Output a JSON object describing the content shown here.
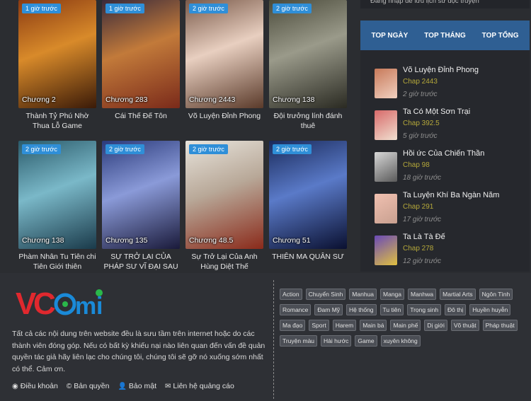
{
  "sidebar_top_text": "Đăng nhập để lưu lịch sử đọc truyện",
  "manga_grid": [
    {
      "badge": "1 giờ trước",
      "chapter": "Chương 2",
      "title": "Thành Tỷ Phú Nhờ Thua Lỗ Game",
      "colors": [
        "#8a3a12",
        "#d88a2a",
        "#3a1a08"
      ]
    },
    {
      "badge": "1 giờ trước",
      "chapter": "Chương 283",
      "title": "Cái Thế Đế Tôn",
      "colors": [
        "#3a2a3a",
        "#c27a3a",
        "#7a2a1a"
      ]
    },
    {
      "badge": "2 giờ trước",
      "chapter": "Chương 2443",
      "title": "Võ Luyện Đỉnh Phong",
      "colors": [
        "#7a5a4a",
        "#e8cfc0",
        "#5a3a2a"
      ]
    },
    {
      "badge": "2 giờ trước",
      "chapter": "Chương 138",
      "title": "Đội trưởng lính đánh thuê",
      "colors": [
        "#4a4a3a",
        "#9a9a8a",
        "#2a2a22"
      ]
    },
    {
      "badge": "2 giờ trước",
      "chapter": "Chương 138",
      "title": "Phàm Nhân Tu Tiên chi Tiên Giới thiên",
      "colors": [
        "#2a5a6a",
        "#7ab8c8",
        "#1a3a4a"
      ]
    },
    {
      "badge": "2 giờ trước",
      "chapter": "Chương 135",
      "title": "SỰ TRỞ LẠI CỦA PHÁP SƯ VĨ ĐẠI SAU",
      "colors": [
        "#2a3a7a",
        "#8a9ad8",
        "#1a1a3a"
      ]
    },
    {
      "badge": "2 giờ trước",
      "chapter": "Chương 48.5",
      "title": "Sự Trở Lại Của Anh Hùng Diệt Thế",
      "colors": [
        "#e8e4dc",
        "#b8a898",
        "#8a2a1a"
      ]
    },
    {
      "badge": "2 giờ trước",
      "chapter": "Chương 51",
      "title": "THIÊN MA QUÂN SƯ",
      "colors": [
        "#1a2a5a",
        "#5a7ac8",
        "#0a1030"
      ]
    }
  ],
  "sidebar": {
    "tabs": [
      "TOP NGÀY",
      "TOP THÁNG",
      "TOP TỔNG"
    ],
    "ranks": [
      {
        "title": "Võ Luyện Đỉnh Phong",
        "chapter": "Chap 2443",
        "time": "2 giờ trước",
        "colors": [
          "#c87a5a",
          "#f0d0c0"
        ]
      },
      {
        "title": "Ta Có Một Sơn Trại",
        "chapter": "Chap 392.5",
        "time": "5 giờ trước",
        "colors": [
          "#d86a6a",
          "#f0e0d0"
        ]
      },
      {
        "title": "Hồi ức Của Chiến Thần",
        "chapter": "Chap 98",
        "time": "18 giờ trước",
        "colors": [
          "#d8d8d8",
          "#5a5a5a"
        ]
      },
      {
        "title": "Ta Luyện Khí Ba Ngàn Năm",
        "chapter": "Chap 291",
        "time": "17 giờ trước",
        "colors": [
          "#f0c0b0",
          "#c8a090"
        ]
      },
      {
        "title": "Ta Là Tà Đế",
        "chapter": "Chap 278",
        "time": "12 giờ trước",
        "colors": [
          "#6a4ab8",
          "#e0c040"
        ]
      }
    ]
  },
  "footer": {
    "logo": {
      "v": "V",
      "c": "C",
      "o": "o",
      "m": "m",
      "i": "i",
      "colors": {
        "red": "#e0282e",
        "blue": "#1a8ad8",
        "green": "#2ab84a"
      }
    },
    "about": "Tất cả các nội dung trên website đều là sưu tầm trên internet hoặc do các thành viên đóng góp. Nếu có bất kỳ khiếu nại nào liên quan đến vấn đề quản quyền tác giả hãy liên lạc cho chúng tôi, chúng tôi sẽ gỡ nó xuống sớm nhất có thể. Cảm ơn.",
    "links": [
      {
        "icon": "circle-info-icon",
        "glyph": "◉",
        "label": "Điều khoản"
      },
      {
        "icon": "copyright-icon",
        "glyph": "©",
        "label": "Bản quyền"
      },
      {
        "icon": "user-shield-icon",
        "glyph": "👤",
        "label": "Bảo mật"
      },
      {
        "icon": "envelope-icon",
        "glyph": "✉",
        "label": "Liên hệ quảng cáo"
      }
    ],
    "tags": [
      "Action",
      "Chuyển Sinh",
      "Manhua",
      "Manga",
      "Manhwa",
      "Martial Arts",
      "Ngôn Tình",
      "Romance",
      "Đam Mỹ",
      "Hệ thống",
      "Tu tiên",
      "Trọng sinh",
      "Đô thị",
      "Huyền huyễn",
      "Ma đạo",
      "Sport",
      "Harem",
      "Main bá",
      "Main phế",
      "Dị giới",
      "Võ thuật",
      "Pháp thuật",
      "Truyện màu",
      "Hài hước",
      "Game",
      "xuyên không"
    ]
  }
}
